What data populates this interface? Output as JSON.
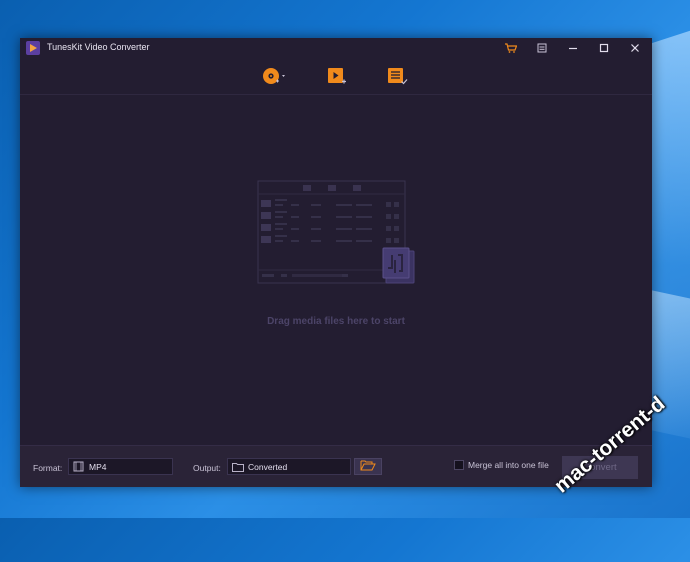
{
  "window": {
    "title": "TunesKit Video Converter"
  },
  "titlebar_buttons": [
    "cart-icon",
    "menu-icon",
    "minimize-icon",
    "maximize-icon",
    "close-icon"
  ],
  "toolbar": {
    "tools": [
      "add-dvd-icon",
      "add-files-icon",
      "converted-list-icon"
    ]
  },
  "dropzone": {
    "text": "Drag media files here to start"
  },
  "bottom": {
    "format_label": "Format:",
    "format_value": "MP4",
    "output_label": "Output:",
    "output_value": "Converted",
    "merge_label": "Merge all into one file",
    "merge_checked": false,
    "convert_label": "Convert"
  },
  "watermark": "mac-torrent-d",
  "colors": {
    "accent": "#f08a1c",
    "window_bg": "#231d31",
    "bottom_bg": "#2a2337"
  }
}
